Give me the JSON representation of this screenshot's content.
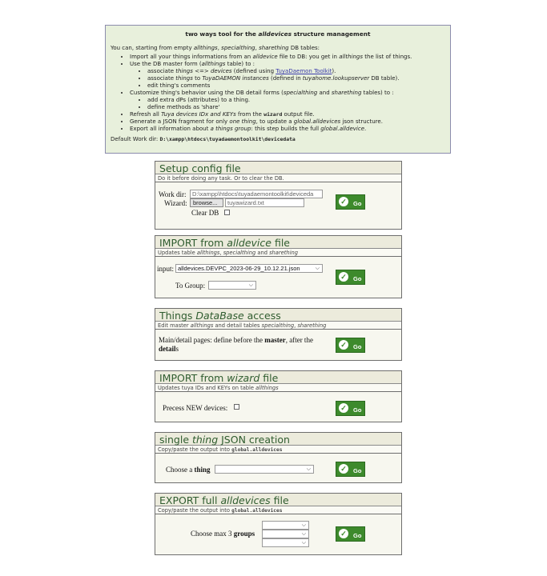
{
  "intro": {
    "title_pre": "two ways tool for the ",
    "title_em": "alldevices",
    "title_post": " structure management",
    "lead": "You can, starting from empty ",
    "lead_em1": "allthings",
    "lead_sep1": ", ",
    "lead_em2": "specialthing",
    "lead_sep2": ", ",
    "lead_em3": "sharething",
    "lead_post": " DB tables:",
    "b1_pre": "Import all your things informations from an ",
    "b1_em1": "alldevice",
    "b1_mid": " file to DB: you get in ",
    "b1_em2": "allthings",
    "b1_post": " the list of things.",
    "b2_pre": "Use the DB master form (",
    "b2_em": "allthings",
    "b2_post": " table) to :",
    "b2a_pre": "associate ",
    "b2a_em1": "things",
    "b2a_mid": " <=> ",
    "b2a_em2": "devices",
    "b2a_mid2": " (defined using ",
    "b2a_link": "TuyaDaemon Toolkit",
    "b2a_post": ").",
    "b2b_pre": "associate ",
    "b2b_em1": "things",
    "b2b_mid": " to ",
    "b2b_em2": "TuyaDAEMON instances",
    "b2b_mid2": " (defined in ",
    "b2b_em3": "tuyahome.lookupserver",
    "b2b_post": " DB table).",
    "b2c": "edit thing's comments",
    "b3_pre": "Customize thing's behavior using the DB detail forms (",
    "b3_em1": "specialthing",
    "b3_mid": " and ",
    "b3_em2": "sharething",
    "b3_post": " tables) to :",
    "b3a": "add extra dPs (attributes) to a thing.",
    "b3b": "define methods as 'share'",
    "b4_pre": "Refresh all ",
    "b4_em": "Tuya devices IDx and KEYs",
    "b4_mid": " from the ",
    "b4_mono": "wizard",
    "b4_post": " output file.",
    "b5_pre": "Generate a JSON fragment for only ",
    "b5_em1": "one thing",
    "b5_mid": ", to update a ",
    "b5_em2": "global.alldevices",
    "b5_post": " json structure.",
    "b6_pre": "Export all information about ",
    "b6_em1": "a things group",
    "b6_mid": ": this step builds the full ",
    "b6_em2": "global.alldevice",
    "b6_post": ".",
    "workdir_label": "Default Work dir: ",
    "workdir_value": "D:\\xampp\\htdocs\\tuyadaemontoolkit\\devicedata"
  },
  "setup": {
    "title": "Setup config file",
    "subtitle": "Do it before doing any task. Or to clear the DB.",
    "workdir_label": "Work dir:",
    "workdir_value": "D:\\xampp\\htdocs\\tuyadaemontoolkit\\deviceda",
    "wizard_label": "Wizard:",
    "browse_label": "browse...",
    "wizard_value": "tuyawizard.txt",
    "clear_label": "Clear DB",
    "go": "Go"
  },
  "import_all": {
    "title_pre": "IMPORT from ",
    "title_em": "alldevice",
    "title_post": " file",
    "sub_pre": "Updates table ",
    "sub_em1": "allthings",
    "sub_sep": ", ",
    "sub_em2": "specialthing",
    "sub_mid": " and ",
    "sub_em3": "sharething",
    "input_label": "input:",
    "input_value": "alldevices.DEVPC_2023-06-29_10.12.21.json",
    "group_label": "To Group:",
    "group_value": "",
    "go": "Go"
  },
  "things_db": {
    "title_pre": "Things ",
    "title_em": "DataBase",
    "title_post": " access",
    "sub_pre": "Edit master ",
    "sub_em1": "allthings",
    "sub_mid": " and detail tables ",
    "sub_em2": "specialthing",
    "sub_sep": ", ",
    "sub_em3": "sharething",
    "desc_pre": "Main/detail pages: define before the ",
    "desc_b1": "master",
    "desc_mid": ", after the ",
    "desc_b2": "detail",
    "desc_post": "s",
    "go": "Go"
  },
  "import_wizard": {
    "title_pre": "IMPORT from ",
    "title_em": "wizard",
    "title_post": " file",
    "sub_pre": "Updates tuya IDs and KEYs on table ",
    "sub_em": "allthings",
    "precess_label": "Precess NEW devices:",
    "go": "Go"
  },
  "single_json": {
    "title_pre": "single ",
    "title_em": "thing",
    "title_post": " JSON creation",
    "sub_pre": "Copy/paste the output into ",
    "sub_mono": "global.alldevices",
    "choose_pre": "Choose a ",
    "choose_b": "thing",
    "thing_value": "",
    "go": "Go"
  },
  "export_full": {
    "title_pre": "EXPORT full ",
    "title_em": "alldevices",
    "title_post": " file",
    "sub_pre": "Copy/paste the output into ",
    "sub_mono": "global.alldevices",
    "choose_pre": "Choose max 3 ",
    "choose_b": "groups",
    "group1": "",
    "group2": "",
    "group3": "",
    "go": "Go"
  },
  "colors": {
    "intro_bg": "#e8f0dc",
    "title_green": "#2f5c2f",
    "go_green": "#3d8a2c",
    "link": "#3a3aaa"
  }
}
